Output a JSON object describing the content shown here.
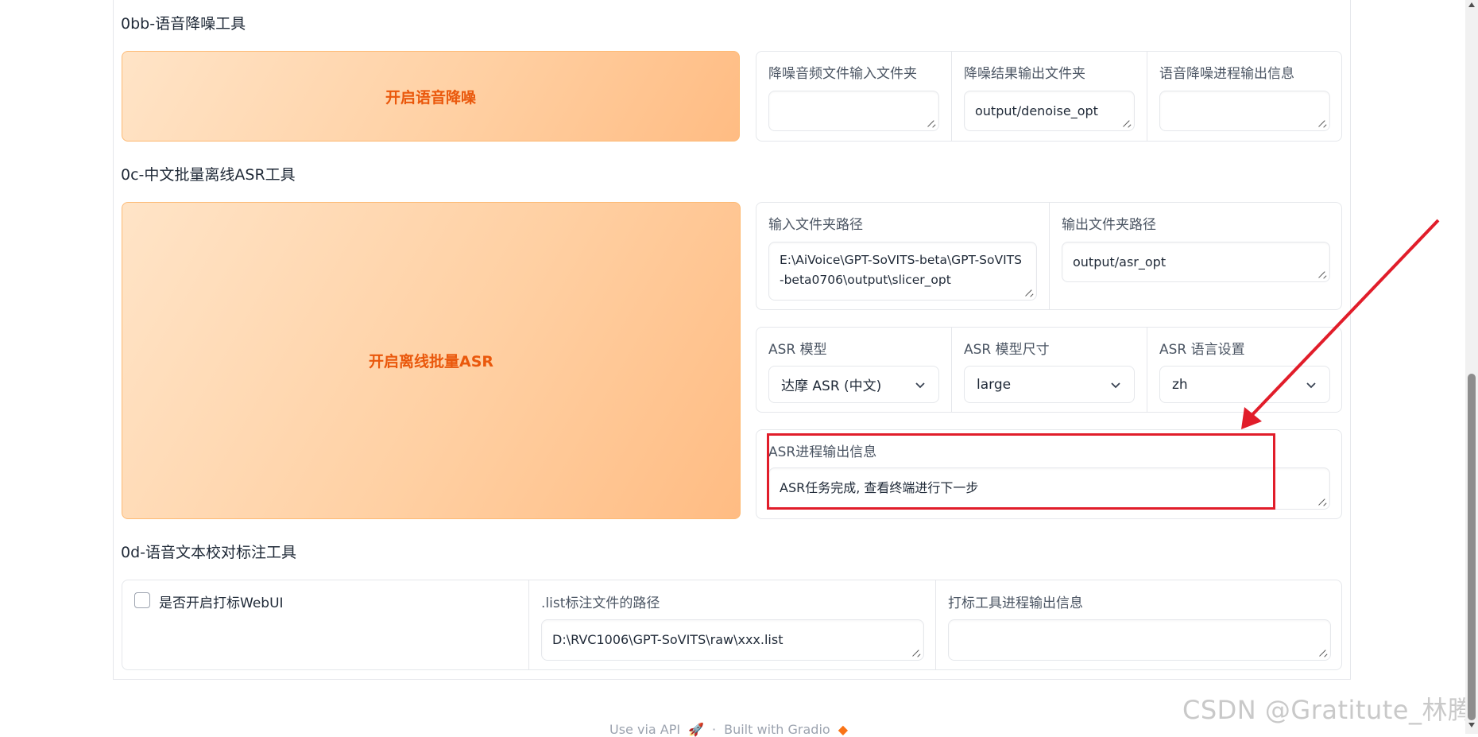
{
  "sections": {
    "denoise": {
      "title": "0bb-语音降噪工具",
      "button_label": "开启语音降噪",
      "input_dir_label": "降噪音频文件输入文件夹",
      "input_dir_value": "",
      "output_dir_label": "降噪结果输出文件夹",
      "output_dir_value": "output/denoise_opt",
      "info_label": "语音降噪进程输出信息",
      "info_value": ""
    },
    "asr": {
      "title": "0c-中文批量离线ASR工具",
      "button_label": "开启离线批量ASR",
      "input_path_label": "输入文件夹路径",
      "input_path_value": "E:\\AiVoice\\GPT-SoVITS-beta\\GPT-SoVITS-beta0706\\output\\slicer_opt",
      "output_path_label": "输出文件夹路径",
      "output_path_value": "output/asr_opt",
      "model_label": "ASR 模型",
      "model_value": "达摩 ASR (中文)",
      "size_label": "ASR 模型尺寸",
      "size_value": "large",
      "lang_label": "ASR 语言设置",
      "lang_value": "zh",
      "info_label": "ASR进程输出信息",
      "info_value": "ASR任务完成, 查看终端进行下一步"
    },
    "label_tool": {
      "title": "0d-语音文本校对标注工具",
      "checkbox_label": "是否开启打标WebUI",
      "checkbox_checked": false,
      "list_path_label": ".list标注文件的路径",
      "list_path_value": "D:\\RVC1006\\GPT-SoVITS\\raw\\xxx.list",
      "info_label": "打标工具进程输出信息",
      "info_value": ""
    }
  },
  "footer": {
    "api_link": "Use via API",
    "separator": "·",
    "built_with": "Built with Gradio"
  },
  "watermark": "CSDN @Gratitute_林腾",
  "colors": {
    "accent": "#ea580c",
    "annotation": "#e11d2a"
  }
}
